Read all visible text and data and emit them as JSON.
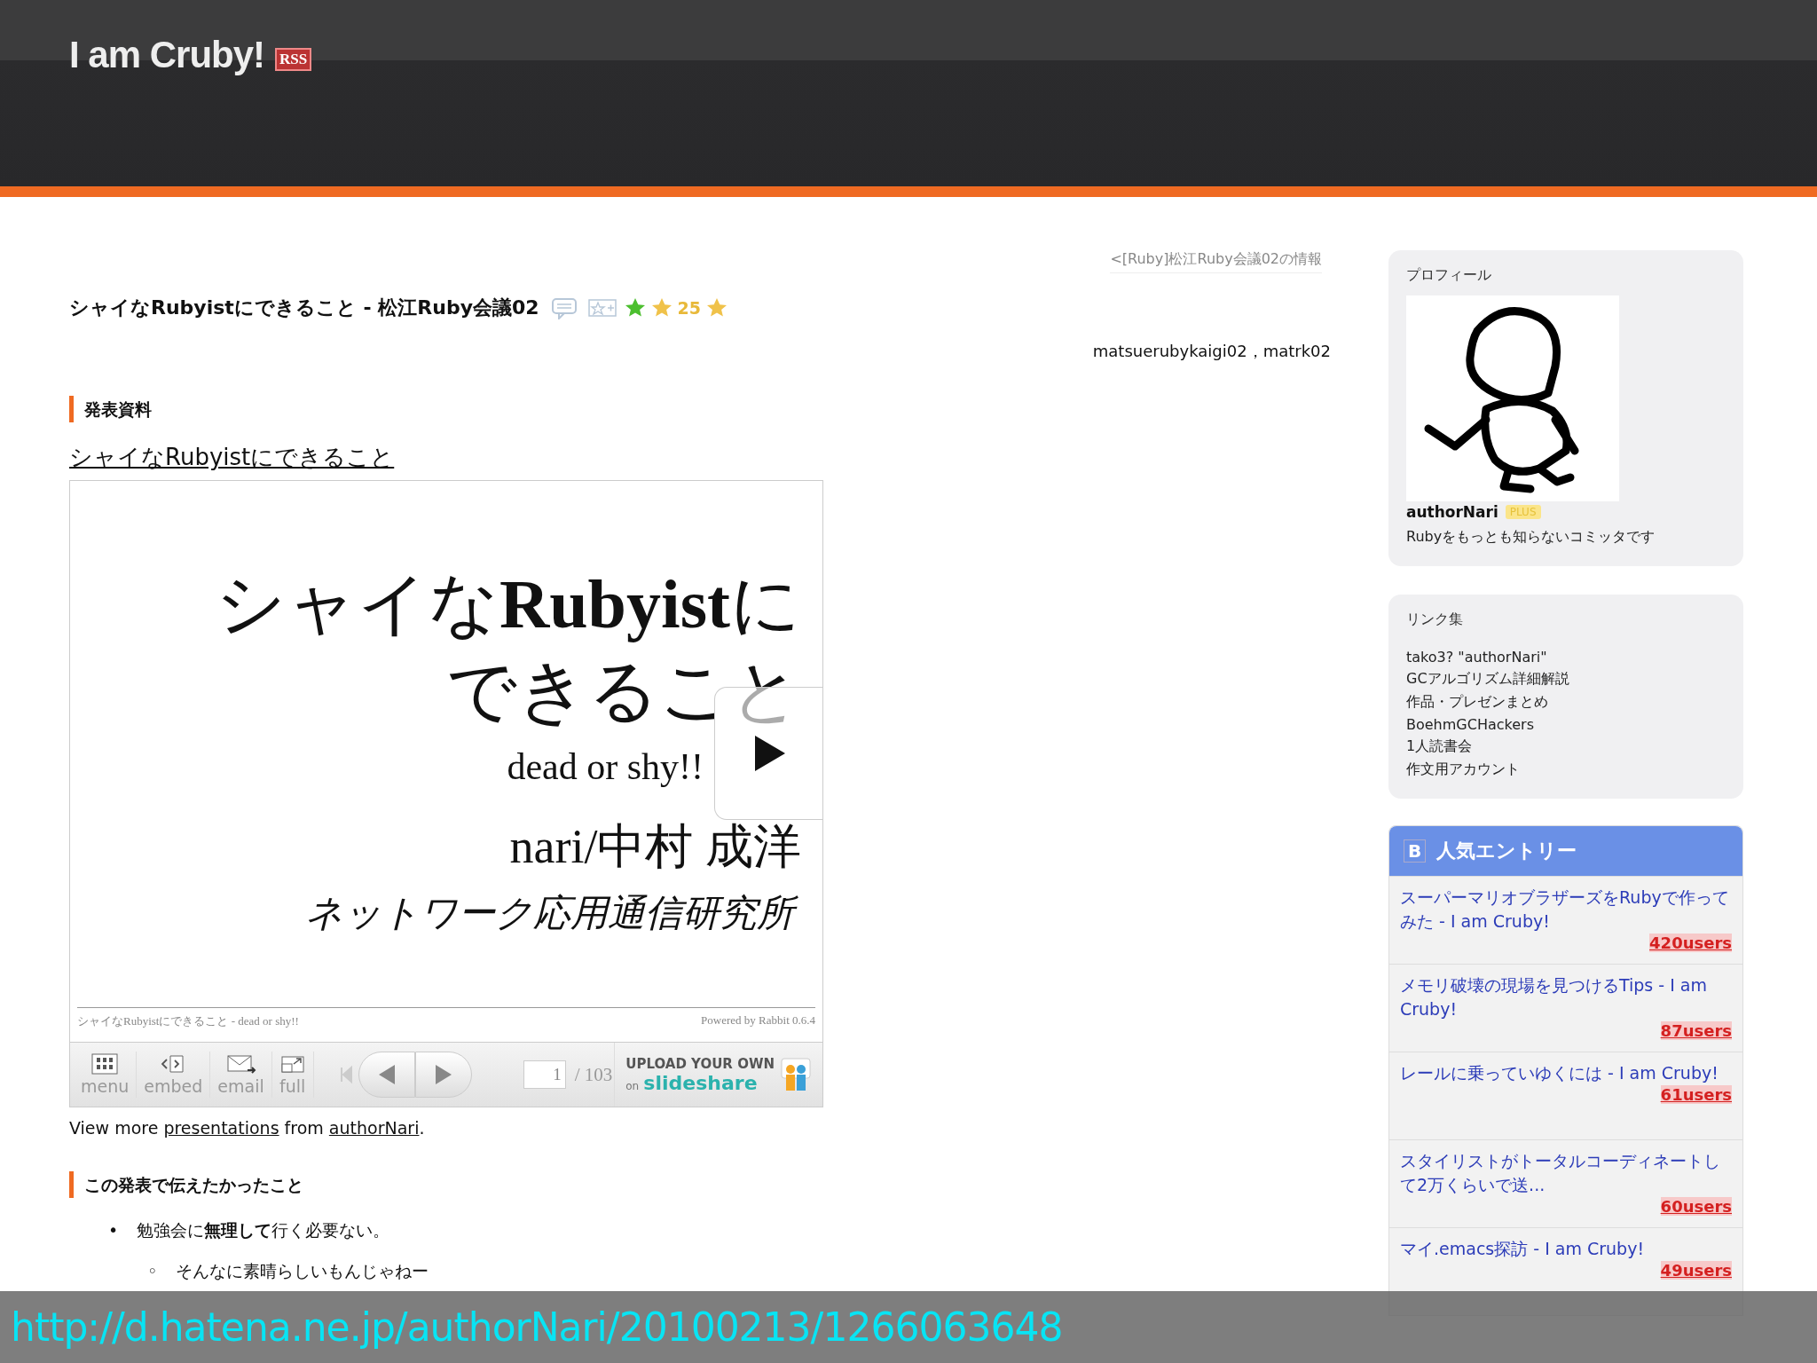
{
  "header": {
    "title": "I am Cruby!",
    "rss": "RSS"
  },
  "post": {
    "prev_link": "<[Ruby]松江Ruby会議02の情報",
    "title": "シャイなRubyistにできること - 松江Ruby会議02",
    "stars_row": [
      {
        "kind": "star",
        "color": "#4cbf2f"
      },
      {
        "kind": "star",
        "color": "#f0c24a"
      },
      {
        "kind": "count",
        "text": "25"
      },
      {
        "kind": "star",
        "color": "#f0c24a"
      }
    ],
    "tags": "matsuerubykaigi02，matrk02"
  },
  "section1": {
    "heading": "発表資料",
    "link": "シャイなRubyistにできること"
  },
  "slideshow": {
    "slide": {
      "title_lines": [
        "シャイな**Rubyist**に",
        "できること"
      ],
      "subtitle": "dead or shy!!",
      "author": "nari/中村 成洋",
      "affiliation": "ネットワーク応用通信研究所",
      "footer_left": "シャイなRubyistにできること - dead or shy!!",
      "footer_right": "Powered by Rabbit 0.6.4"
    },
    "toolbar": {
      "buttons": [
        {
          "kind": "menu",
          "label": "menu"
        },
        {
          "kind": "embed",
          "label": "embed"
        },
        {
          "kind": "email",
          "label": "email"
        },
        {
          "kind": "full",
          "label": "full"
        }
      ],
      "page": "1",
      "total": "/ 103",
      "upload": "UPLOAD YOUR OWN",
      "on": "on",
      "brand": "slideshare"
    }
  },
  "view_more": {
    "prefix": "View more",
    "link1": "presentations",
    "middle": "from",
    "link2": "authorNari",
    "suffix": "."
  },
  "section2": {
    "heading": "この発表で伝えたかったこと",
    "bullets": [
      {
        "marker": "•",
        "text": "勉強会に**無理して**行く必要ない。",
        "children": [
          {
            "marker": "◦",
            "text": "そんなに素晴らしいもんじゃねー"
          }
        ]
      }
    ]
  },
  "sidebar": {
    "profile": {
      "title": "プロフィール",
      "name": "authorNari",
      "badge": "PLUS",
      "bio": "Rubyをもっとも知らないコミッタです"
    },
    "links": {
      "title": "リンク集",
      "items": [
        "tako3? \"authorNari\"",
        "GCアルゴリズム詳細解説",
        "作品・プレゼンまとめ",
        "BoehmGCHackers",
        "1人読書会",
        "作文用アカウント"
      ]
    },
    "popular": {
      "logo": "B",
      "title": "人気エントリー",
      "entries": [
        {
          "title": "スーパーマリオブラザーズをRubyで作ってみた - I am Cruby!",
          "users": "420users"
        },
        {
          "title": "メモリ破壊の現場を見つけるTips - I am Cruby!",
          "users": "87users"
        },
        {
          "title": "レールに乗っていゆくには - I am Cruby!",
          "users": "61users"
        },
        {
          "title": "スタイリストがトータルコーディネートして2万くらいで送...",
          "users": "60users"
        },
        {
          "title": "マイ.emacs探訪 - I am Cruby!",
          "users": "49users"
        }
      ]
    }
  },
  "overlay": {
    "url": "http://d.hatena.ne.jp/authorNari/20100213/1266063648"
  }
}
